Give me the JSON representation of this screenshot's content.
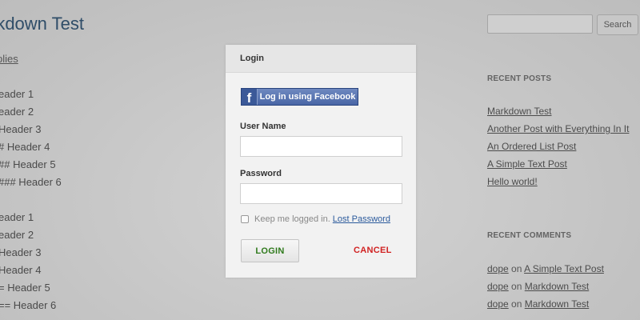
{
  "page": {
    "post_title": "rkdown Test",
    "replies_link": "plies",
    "header_lines": [
      "eader 1",
      "eader 2",
      "Header 3",
      "# Header 4",
      "## Header 5",
      "### Header 6",
      "eader 1",
      "eader 2",
      "Header 3",
      "Header 4",
      "= Header 5",
      "== Header 6"
    ]
  },
  "sidebar": {
    "search": {
      "placeholder": "",
      "button_label": "Search"
    },
    "recent_posts": {
      "title": "RECENT POSTS",
      "items": [
        "Markdown Test",
        "Another Post with Everything In It",
        "An Ordered List Post",
        "A Simple Text Post",
        "Hello world!"
      ]
    },
    "recent_comments": {
      "title": "RECENT COMMENTS",
      "items": [
        {
          "author": "dope",
          "connector": "on",
          "post": "A Simple Text Post"
        },
        {
          "author": "dope",
          "connector": "on",
          "post": "Markdown Test"
        },
        {
          "author": "dope",
          "connector": "on",
          "post": "Markdown Test"
        }
      ]
    }
  },
  "login_modal": {
    "title": "Login",
    "facebook_button": {
      "logo": "f",
      "label": "Log in using Facebook"
    },
    "username_label": "User Name",
    "username_value": "",
    "password_label": "Password",
    "password_value": "",
    "remember_label": "Keep me logged in.",
    "lost_password_link": "Lost Password",
    "login_button": "LOGIN",
    "cancel_link": "CANCEL"
  },
  "colors": {
    "facebook_blue": "#3b5998",
    "login_green": "#2f7a1c",
    "cancel_red": "#d12222",
    "link_blue": "#2b5a9c"
  }
}
